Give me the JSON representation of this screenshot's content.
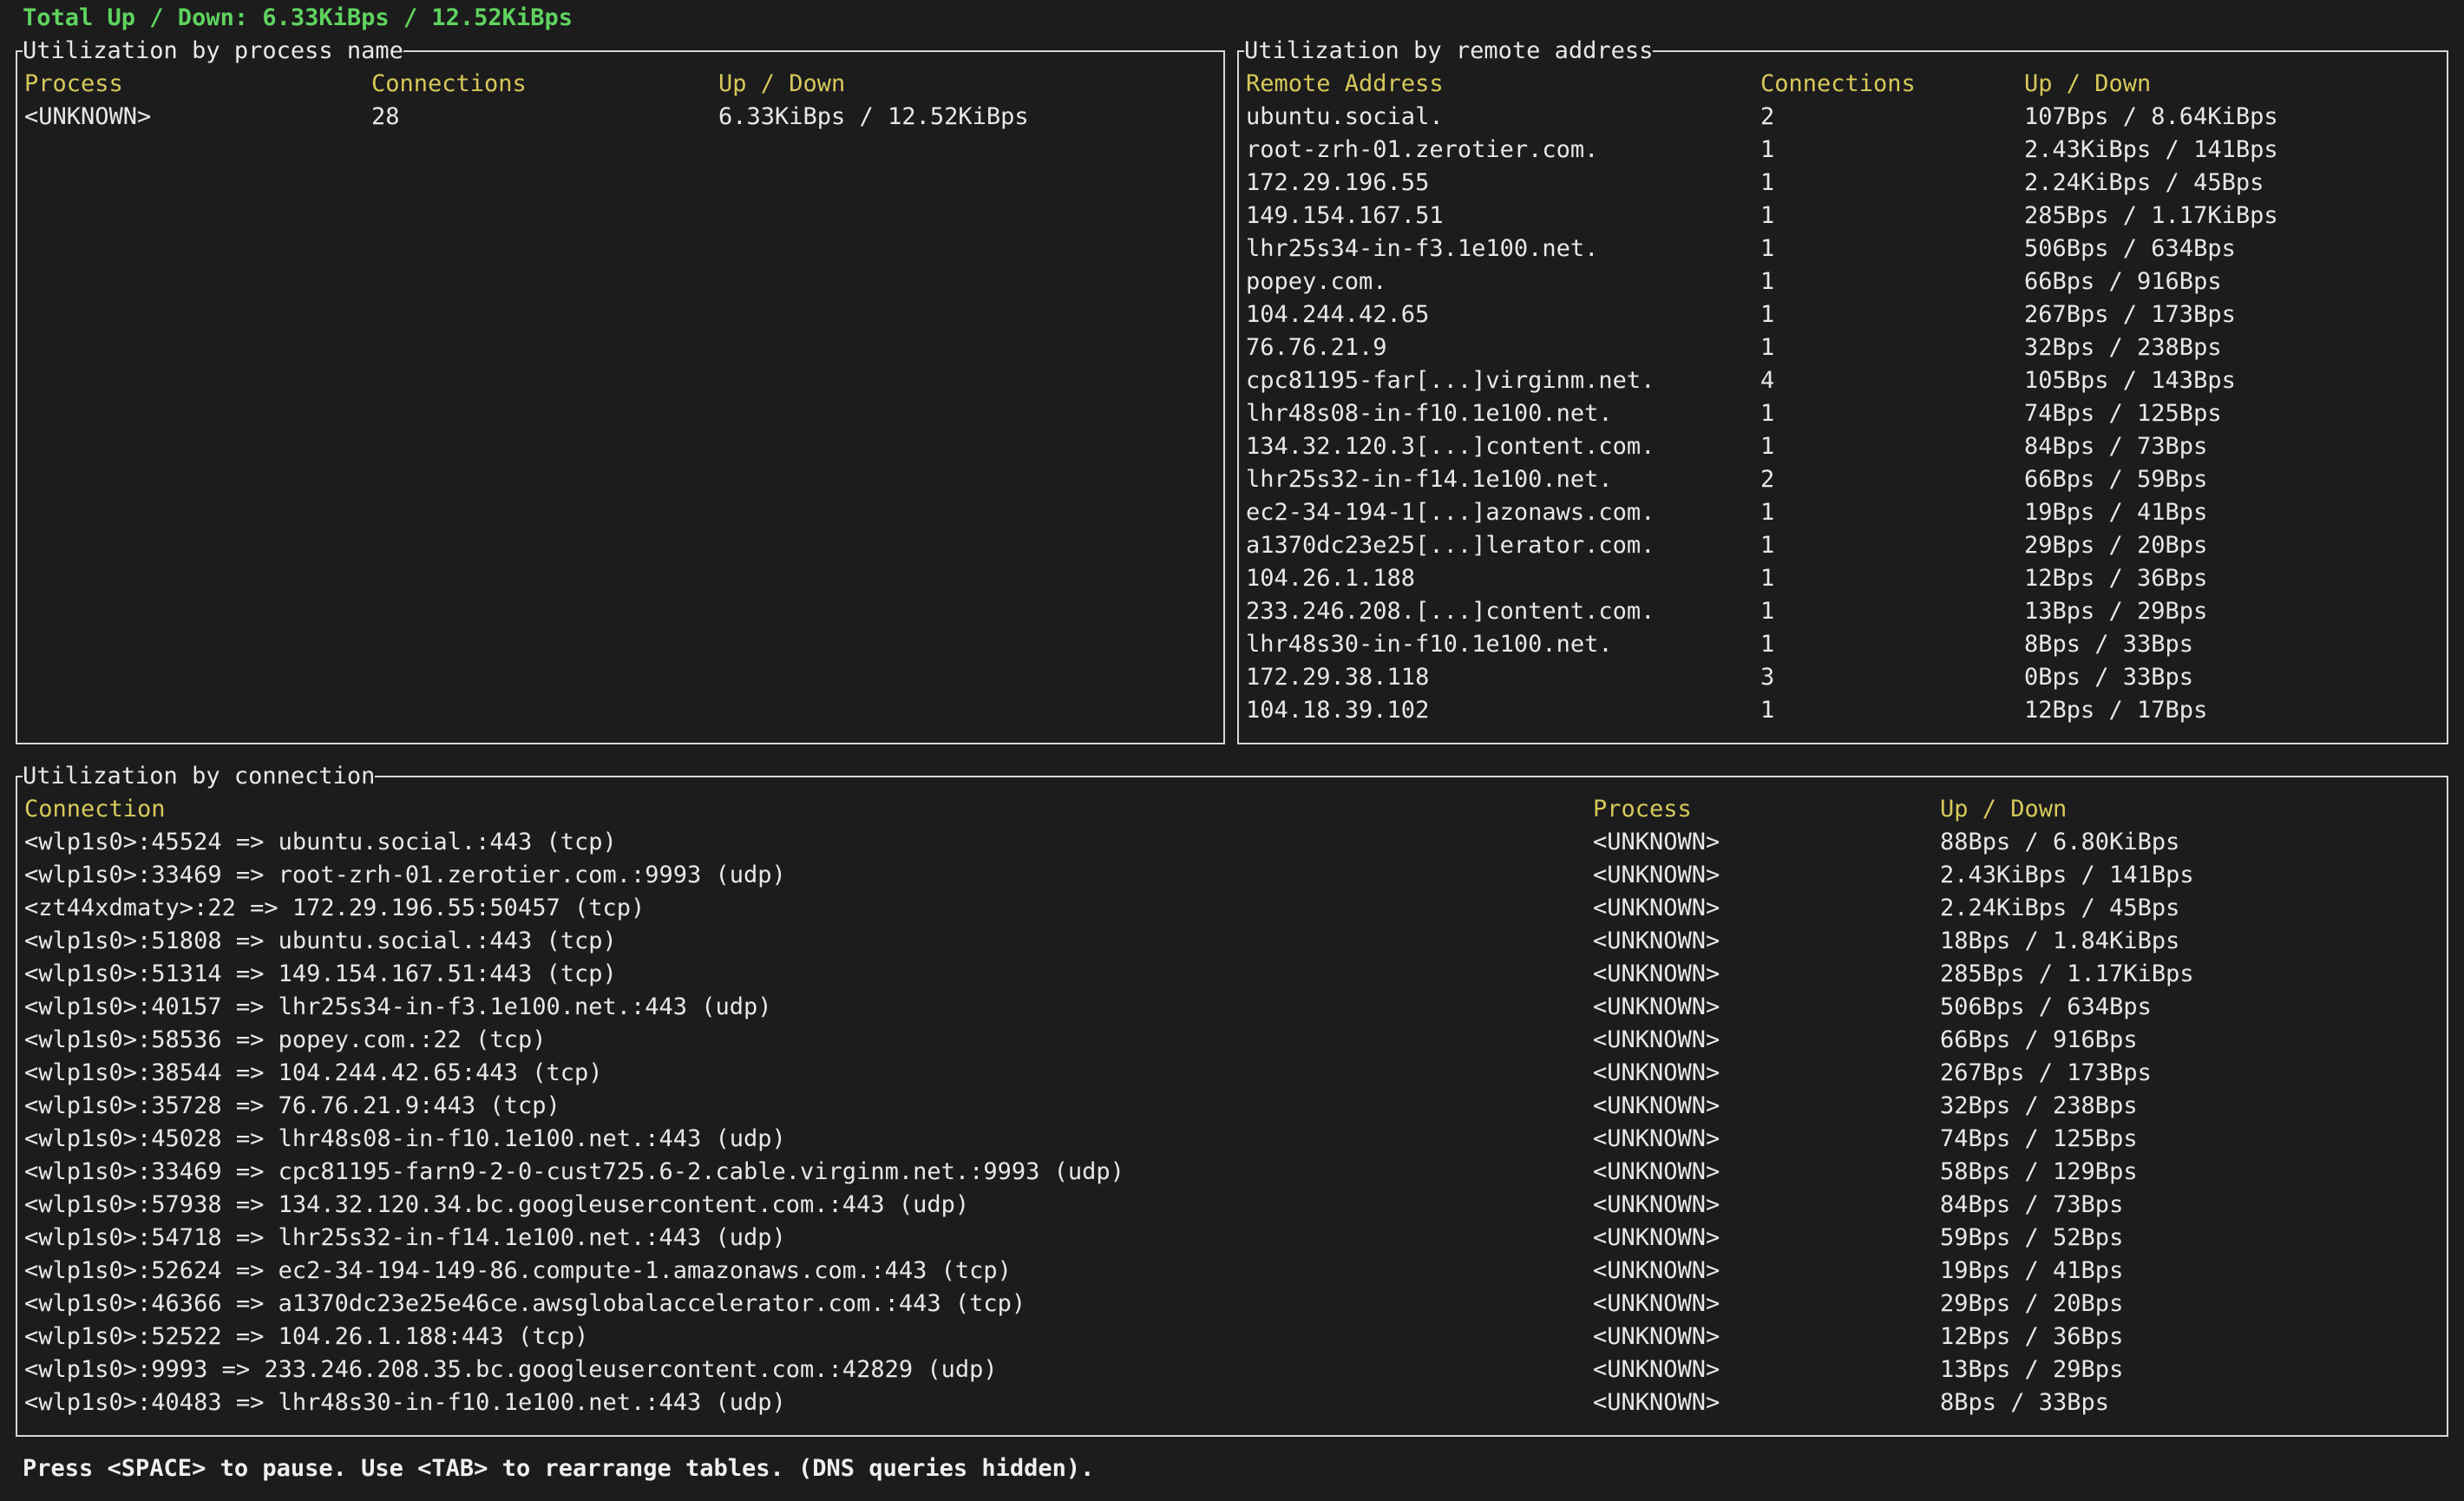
{
  "total": "Total Up / Down: 6.33KiBps / 12.52KiBps",
  "footer": "Press <SPACE> to pause. Use <TAB> to rearrange tables. (DNS queries hidden).",
  "colors": {
    "background": "#1c1c1c",
    "header": "#d7c95a",
    "total": "#5fd35f",
    "text": "#e8e8e8",
    "border": "#d8d8d8"
  },
  "process_panel": {
    "title": "Utilization by process name",
    "headers": [
      "Process",
      "Connections",
      "Up / Down"
    ],
    "rows": [
      [
        "<UNKNOWN>",
        "28",
        "6.33KiBps / 12.52KiBps"
      ]
    ]
  },
  "remote_panel": {
    "title": "Utilization by remote address",
    "headers": [
      "Remote Address",
      "Connections",
      "Up / Down"
    ],
    "rows": [
      [
        "ubuntu.social.",
        "2",
        "107Bps / 8.64KiBps"
      ],
      [
        "root-zrh-01.zerotier.com.",
        "1",
        "2.43KiBps / 141Bps"
      ],
      [
        "172.29.196.55",
        "1",
        "2.24KiBps / 45Bps"
      ],
      [
        "149.154.167.51",
        "1",
        "285Bps / 1.17KiBps"
      ],
      [
        "lhr25s34-in-f3.1e100.net.",
        "1",
        "506Bps / 634Bps"
      ],
      [
        "popey.com.",
        "1",
        "66Bps / 916Bps"
      ],
      [
        "104.244.42.65",
        "1",
        "267Bps / 173Bps"
      ],
      [
        "76.76.21.9",
        "1",
        "32Bps / 238Bps"
      ],
      [
        "cpc81195-far[...]virginm.net.",
        "4",
        "105Bps / 143Bps"
      ],
      [
        "lhr48s08-in-f10.1e100.net.",
        "1",
        "74Bps / 125Bps"
      ],
      [
        "134.32.120.3[...]content.com.",
        "1",
        "84Bps / 73Bps"
      ],
      [
        "lhr25s32-in-f14.1e100.net.",
        "2",
        "66Bps / 59Bps"
      ],
      [
        "ec2-34-194-1[...]azonaws.com.",
        "1",
        "19Bps / 41Bps"
      ],
      [
        "a1370dc23e25[...]lerator.com.",
        "1",
        "29Bps / 20Bps"
      ],
      [
        "104.26.1.188",
        "1",
        "12Bps / 36Bps"
      ],
      [
        "233.246.208.[...]content.com.",
        "1",
        "13Bps / 29Bps"
      ],
      [
        "lhr48s30-in-f10.1e100.net.",
        "1",
        "8Bps / 33Bps"
      ],
      [
        "172.29.38.118",
        "3",
        "0Bps / 33Bps"
      ],
      [
        "104.18.39.102",
        "1",
        "12Bps / 17Bps"
      ]
    ]
  },
  "connection_panel": {
    "title": "Utilization by connection",
    "headers": [
      "Connection",
      "Process",
      "Up / Down"
    ],
    "rows": [
      [
        "<wlp1s0>:45524 => ubuntu.social.:443 (tcp)",
        "<UNKNOWN>",
        "88Bps / 6.80KiBps"
      ],
      [
        "<wlp1s0>:33469 => root-zrh-01.zerotier.com.:9993 (udp)",
        "<UNKNOWN>",
        "2.43KiBps / 141Bps"
      ],
      [
        "<zt44xdmaty>:22 => 172.29.196.55:50457 (tcp)",
        "<UNKNOWN>",
        "2.24KiBps / 45Bps"
      ],
      [
        "<wlp1s0>:51808 => ubuntu.social.:443 (tcp)",
        "<UNKNOWN>",
        "18Bps / 1.84KiBps"
      ],
      [
        "<wlp1s0>:51314 => 149.154.167.51:443 (tcp)",
        "<UNKNOWN>",
        "285Bps / 1.17KiBps"
      ],
      [
        "<wlp1s0>:40157 => lhr25s34-in-f3.1e100.net.:443 (udp)",
        "<UNKNOWN>",
        "506Bps / 634Bps"
      ],
      [
        "<wlp1s0>:58536 => popey.com.:22 (tcp)",
        "<UNKNOWN>",
        "66Bps / 916Bps"
      ],
      [
        "<wlp1s0>:38544 => 104.244.42.65:443 (tcp)",
        "<UNKNOWN>",
        "267Bps / 173Bps"
      ],
      [
        "<wlp1s0>:35728 => 76.76.21.9:443 (tcp)",
        "<UNKNOWN>",
        "32Bps / 238Bps"
      ],
      [
        "<wlp1s0>:45028 => lhr48s08-in-f10.1e100.net.:443 (udp)",
        "<UNKNOWN>",
        "74Bps / 125Bps"
      ],
      [
        "<wlp1s0>:33469 => cpc81195-farn9-2-0-cust725.6-2.cable.virginm.net.:9993 (udp)",
        "<UNKNOWN>",
        "58Bps / 129Bps"
      ],
      [
        "<wlp1s0>:57938 => 134.32.120.34.bc.googleusercontent.com.:443 (udp)",
        "<UNKNOWN>",
        "84Bps / 73Bps"
      ],
      [
        "<wlp1s0>:54718 => lhr25s32-in-f14.1e100.net.:443 (udp)",
        "<UNKNOWN>",
        "59Bps / 52Bps"
      ],
      [
        "<wlp1s0>:52624 => ec2-34-194-149-86.compute-1.amazonaws.com.:443 (tcp)",
        "<UNKNOWN>",
        "19Bps / 41Bps"
      ],
      [
        "<wlp1s0>:46366 => a1370dc23e25e46ce.awsglobalaccelerator.com.:443 (tcp)",
        "<UNKNOWN>",
        "29Bps / 20Bps"
      ],
      [
        "<wlp1s0>:52522 => 104.26.1.188:443 (tcp)",
        "<UNKNOWN>",
        "12Bps / 36Bps"
      ],
      [
        "<wlp1s0>:9993 => 233.246.208.35.bc.googleusercontent.com.:42829 (udp)",
        "<UNKNOWN>",
        "13Bps / 29Bps"
      ],
      [
        "<wlp1s0>:40483 => lhr48s30-in-f10.1e100.net.:443 (udp)",
        "<UNKNOWN>",
        "8Bps / 33Bps"
      ]
    ]
  }
}
